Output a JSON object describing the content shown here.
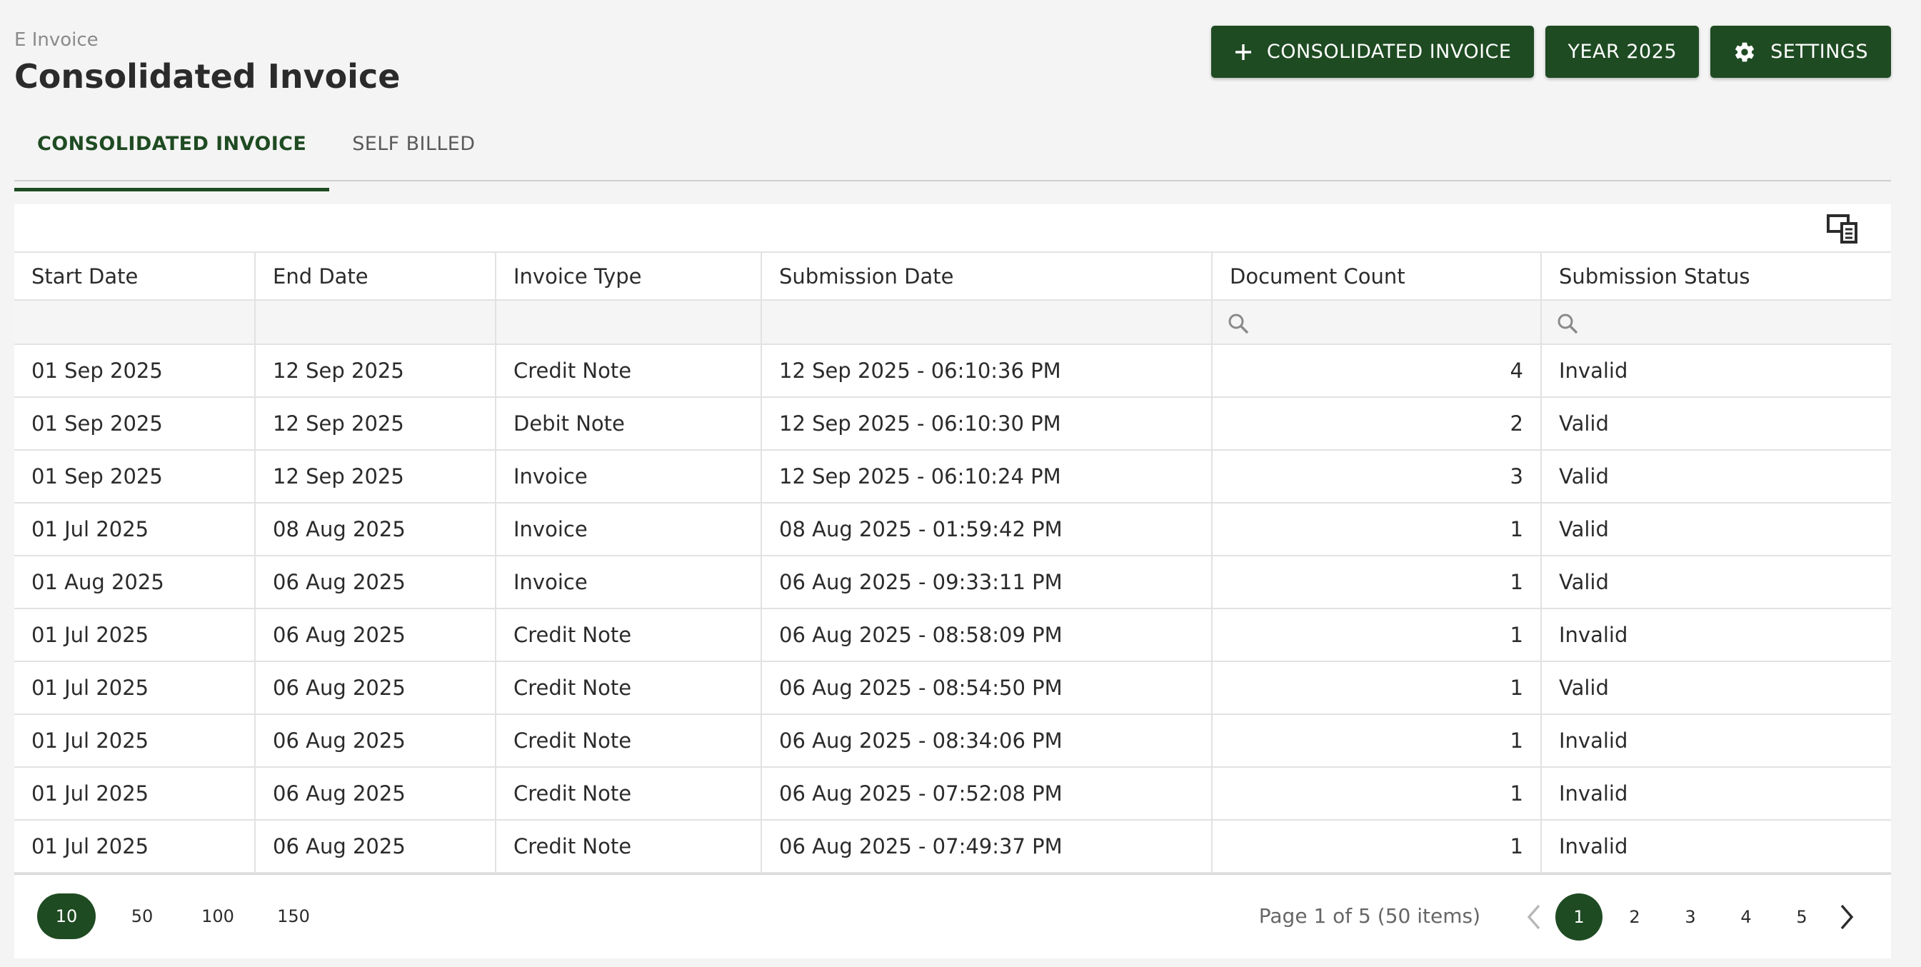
{
  "breadcrumb": "E Invoice",
  "page_title": "Consolidated Invoice",
  "actions": {
    "consolidated_label": "CONSOLIDATED INVOICE",
    "year_label": "YEAR 2025",
    "settings_label": "SETTINGS"
  },
  "tabs": [
    {
      "label": "CONSOLIDATED INVOICE",
      "active": true
    },
    {
      "label": "SELF BILLED",
      "active": false
    }
  ],
  "table": {
    "columns": [
      "Start Date",
      "End Date",
      "Invoice Type",
      "Submission Date",
      "Document Count",
      "Submission Status"
    ],
    "rows": [
      [
        "01 Sep 2025",
        "12 Sep 2025",
        "Credit Note",
        "12 Sep 2025 - 06:10:36 PM",
        "4",
        "Invalid"
      ],
      [
        "01 Sep 2025",
        "12 Sep 2025",
        "Debit Note",
        "12 Sep 2025 - 06:10:30 PM",
        "2",
        "Valid"
      ],
      [
        "01 Sep 2025",
        "12 Sep 2025",
        "Invoice",
        "12 Sep 2025 - 06:10:24 PM",
        "3",
        "Valid"
      ],
      [
        "01 Jul 2025",
        "08 Aug 2025",
        "Invoice",
        "08 Aug 2025 - 01:59:42 PM",
        "1",
        "Valid"
      ],
      [
        "01 Aug 2025",
        "06 Aug 2025",
        "Invoice",
        "06 Aug 2025 - 09:33:11 PM",
        "1",
        "Valid"
      ],
      [
        "01 Jul 2025",
        "06 Aug 2025",
        "Credit Note",
        "06 Aug 2025 - 08:58:09 PM",
        "1",
        "Invalid"
      ],
      [
        "01 Jul 2025",
        "06 Aug 2025",
        "Credit Note",
        "06 Aug 2025 - 08:54:50 PM",
        "1",
        "Valid"
      ],
      [
        "01 Jul 2025",
        "06 Aug 2025",
        "Credit Note",
        "06 Aug 2025 - 08:34:06 PM",
        "1",
        "Invalid"
      ],
      [
        "01 Jul 2025",
        "06 Aug 2025",
        "Credit Note",
        "06 Aug 2025 - 07:52:08 PM",
        "1",
        "Invalid"
      ],
      [
        "01 Jul 2025",
        "06 Aug 2025",
        "Credit Note",
        "06 Aug 2025 - 07:49:37 PM",
        "1",
        "Invalid"
      ]
    ]
  },
  "pager": {
    "page_sizes": [
      "10",
      "50",
      "100",
      "150"
    ],
    "selected_size": "10",
    "info": "Page 1 of 5 (50 items)",
    "pages": [
      "1",
      "2",
      "3",
      "4",
      "5"
    ],
    "current_page": "1"
  },
  "colors": {
    "accent": "#1f4b22",
    "background": "#f4f4f4",
    "grid_border": "#e2e2e2"
  },
  "icons": [
    "plus-icon",
    "gear-icon",
    "column-chooser-icon",
    "search-icon",
    "chevron-left-icon",
    "chevron-right-icon"
  ]
}
